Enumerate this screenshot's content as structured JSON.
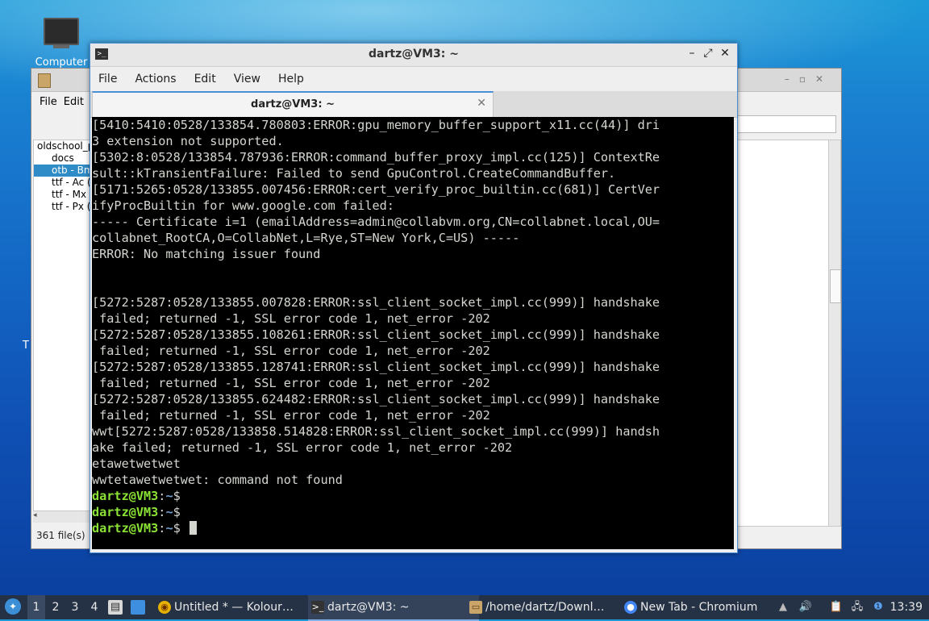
{
  "desktop": {
    "computer_label": "Computer",
    "trash_label_fragment": "T"
  },
  "file_manager": {
    "menu": [
      "File",
      "Edit"
    ],
    "tree": [
      {
        "label": "oldschool_p",
        "root": true,
        "selected": false
      },
      {
        "label": "docs",
        "root": false,
        "selected": false
      },
      {
        "label": "otb - Bm",
        "root": false,
        "selected": true
      },
      {
        "label": "ttf - Ac (",
        "root": false,
        "selected": false
      },
      {
        "label": "ttf - Mx",
        "root": false,
        "selected": false
      },
      {
        "label": "ttf - Px (",
        "root": false,
        "selected": false
      }
    ],
    "status": "361 file(s)"
  },
  "terminal": {
    "title": "dartz@VM3: ~",
    "menu": {
      "file": "File",
      "actions": "Actions",
      "edit": "Edit",
      "view": "View",
      "help": "Help"
    },
    "tab_label": "dartz@VM3: ~",
    "lines": [
      "[5410:5410:0528/133854.780803:ERROR:gpu_memory_buffer_support_x11.cc(44)] dri",
      "3 extension not supported.",
      "[5302:8:0528/133854.787936:ERROR:command_buffer_proxy_impl.cc(125)] ContextRe",
      "sult::kTransientFailure: Failed to send GpuControl.CreateCommandBuffer.",
      "[5171:5265:0528/133855.007456:ERROR:cert_verify_proc_builtin.cc(681)] CertVer",
      "ifyProcBuiltin for www.google.com failed:",
      "----- Certificate i=1 (emailAddress=admin@collabvm.org,CN=collabnet.local,OU=",
      "collabnet_RootCA,O=CollabNet,L=Rye,ST=New York,C=US) -----",
      "ERROR: No matching issuer found",
      "",
      "",
      "[5272:5287:0528/133855.007828:ERROR:ssl_client_socket_impl.cc(999)] handshake",
      " failed; returned -1, SSL error code 1, net_error -202",
      "[5272:5287:0528/133855.108261:ERROR:ssl_client_socket_impl.cc(999)] handshake",
      " failed; returned -1, SSL error code 1, net_error -202",
      "[5272:5287:0528/133855.128741:ERROR:ssl_client_socket_impl.cc(999)] handshake",
      " failed; returned -1, SSL error code 1, net_error -202",
      "[5272:5287:0528/133855.624482:ERROR:ssl_client_socket_impl.cc(999)] handshake",
      " failed; returned -1, SSL error code 1, net_error -202",
      "wwt[5272:5287:0528/133858.514828:ERROR:ssl_client_socket_impl.cc(999)] handsh",
      "ake failed; returned -1, SSL error code 1, net_error -202",
      "etawetwetwet",
      "wwtetawetwetwet: command not found"
    ],
    "prompt": {
      "user_host": "dartz@VM3",
      "sep": ":",
      "path": "~",
      "symbol": "$"
    },
    "prompt_count": 3,
    "colors": {
      "prompt_user": "#8ae234",
      "prompt_path": "#729fcf",
      "text": "#d3d7cf",
      "background": "#000000"
    }
  },
  "taskbar": {
    "workspaces": [
      "1",
      "2",
      "3",
      "4"
    ],
    "active_workspace": "1",
    "tasks": [
      {
        "label": "Untitled * — Kolour…",
        "icon": "kolourpaint-icon"
      },
      {
        "label": "dartz@VM3: ~",
        "icon": "terminal-icon"
      },
      {
        "label": "/home/dartz/Downl…",
        "icon": "file-manager-icon"
      },
      {
        "label": "New Tab - Chromium",
        "icon": "chromium-icon"
      }
    ],
    "active_task": "dartz@VM3: ~",
    "clock": "13:39"
  }
}
